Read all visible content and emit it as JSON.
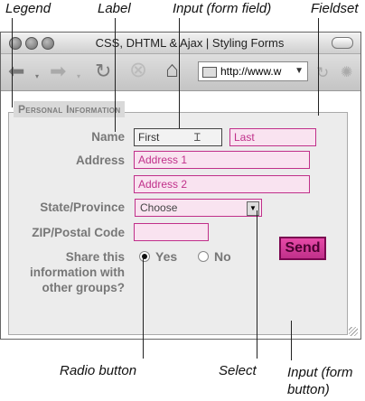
{
  "callouts": {
    "legend": "Legend",
    "label": "Label",
    "input_field": "Input (form field)",
    "fieldset": "Fieldset",
    "radio_button": "Radio button",
    "select": "Select",
    "input_button_line1": "Input (form",
    "input_button_line2": "button)"
  },
  "window": {
    "title": "CSS, DHTML & Ajax | Styling Forms",
    "url": "http://www.w"
  },
  "toolbar": {
    "back_icon": "back-arrow-icon",
    "forward_icon": "forward-arrow-icon",
    "reload_icon": "reload-icon",
    "stop_icon": "stop-icon",
    "home_icon": "home-icon"
  },
  "form": {
    "legend": "Personal Information",
    "name_label": "Name",
    "first_value": "First",
    "last_placeholder": "Last",
    "address_label": "Address",
    "address1_placeholder": "Address 1",
    "address2_placeholder": "Address 2",
    "state_label": "State/Province",
    "state_selected": "Choose",
    "zip_label": "ZIP/Postal Code",
    "share_label_1": "Share this",
    "share_label_2": "information with",
    "share_label_3": "other groups?",
    "radio_yes": "Yes",
    "radio_no": "No",
    "send_label": "Send"
  },
  "colors": {
    "accent": "#c0308a",
    "field_bg": "#f9e3f0",
    "label_gray": "#777777"
  }
}
